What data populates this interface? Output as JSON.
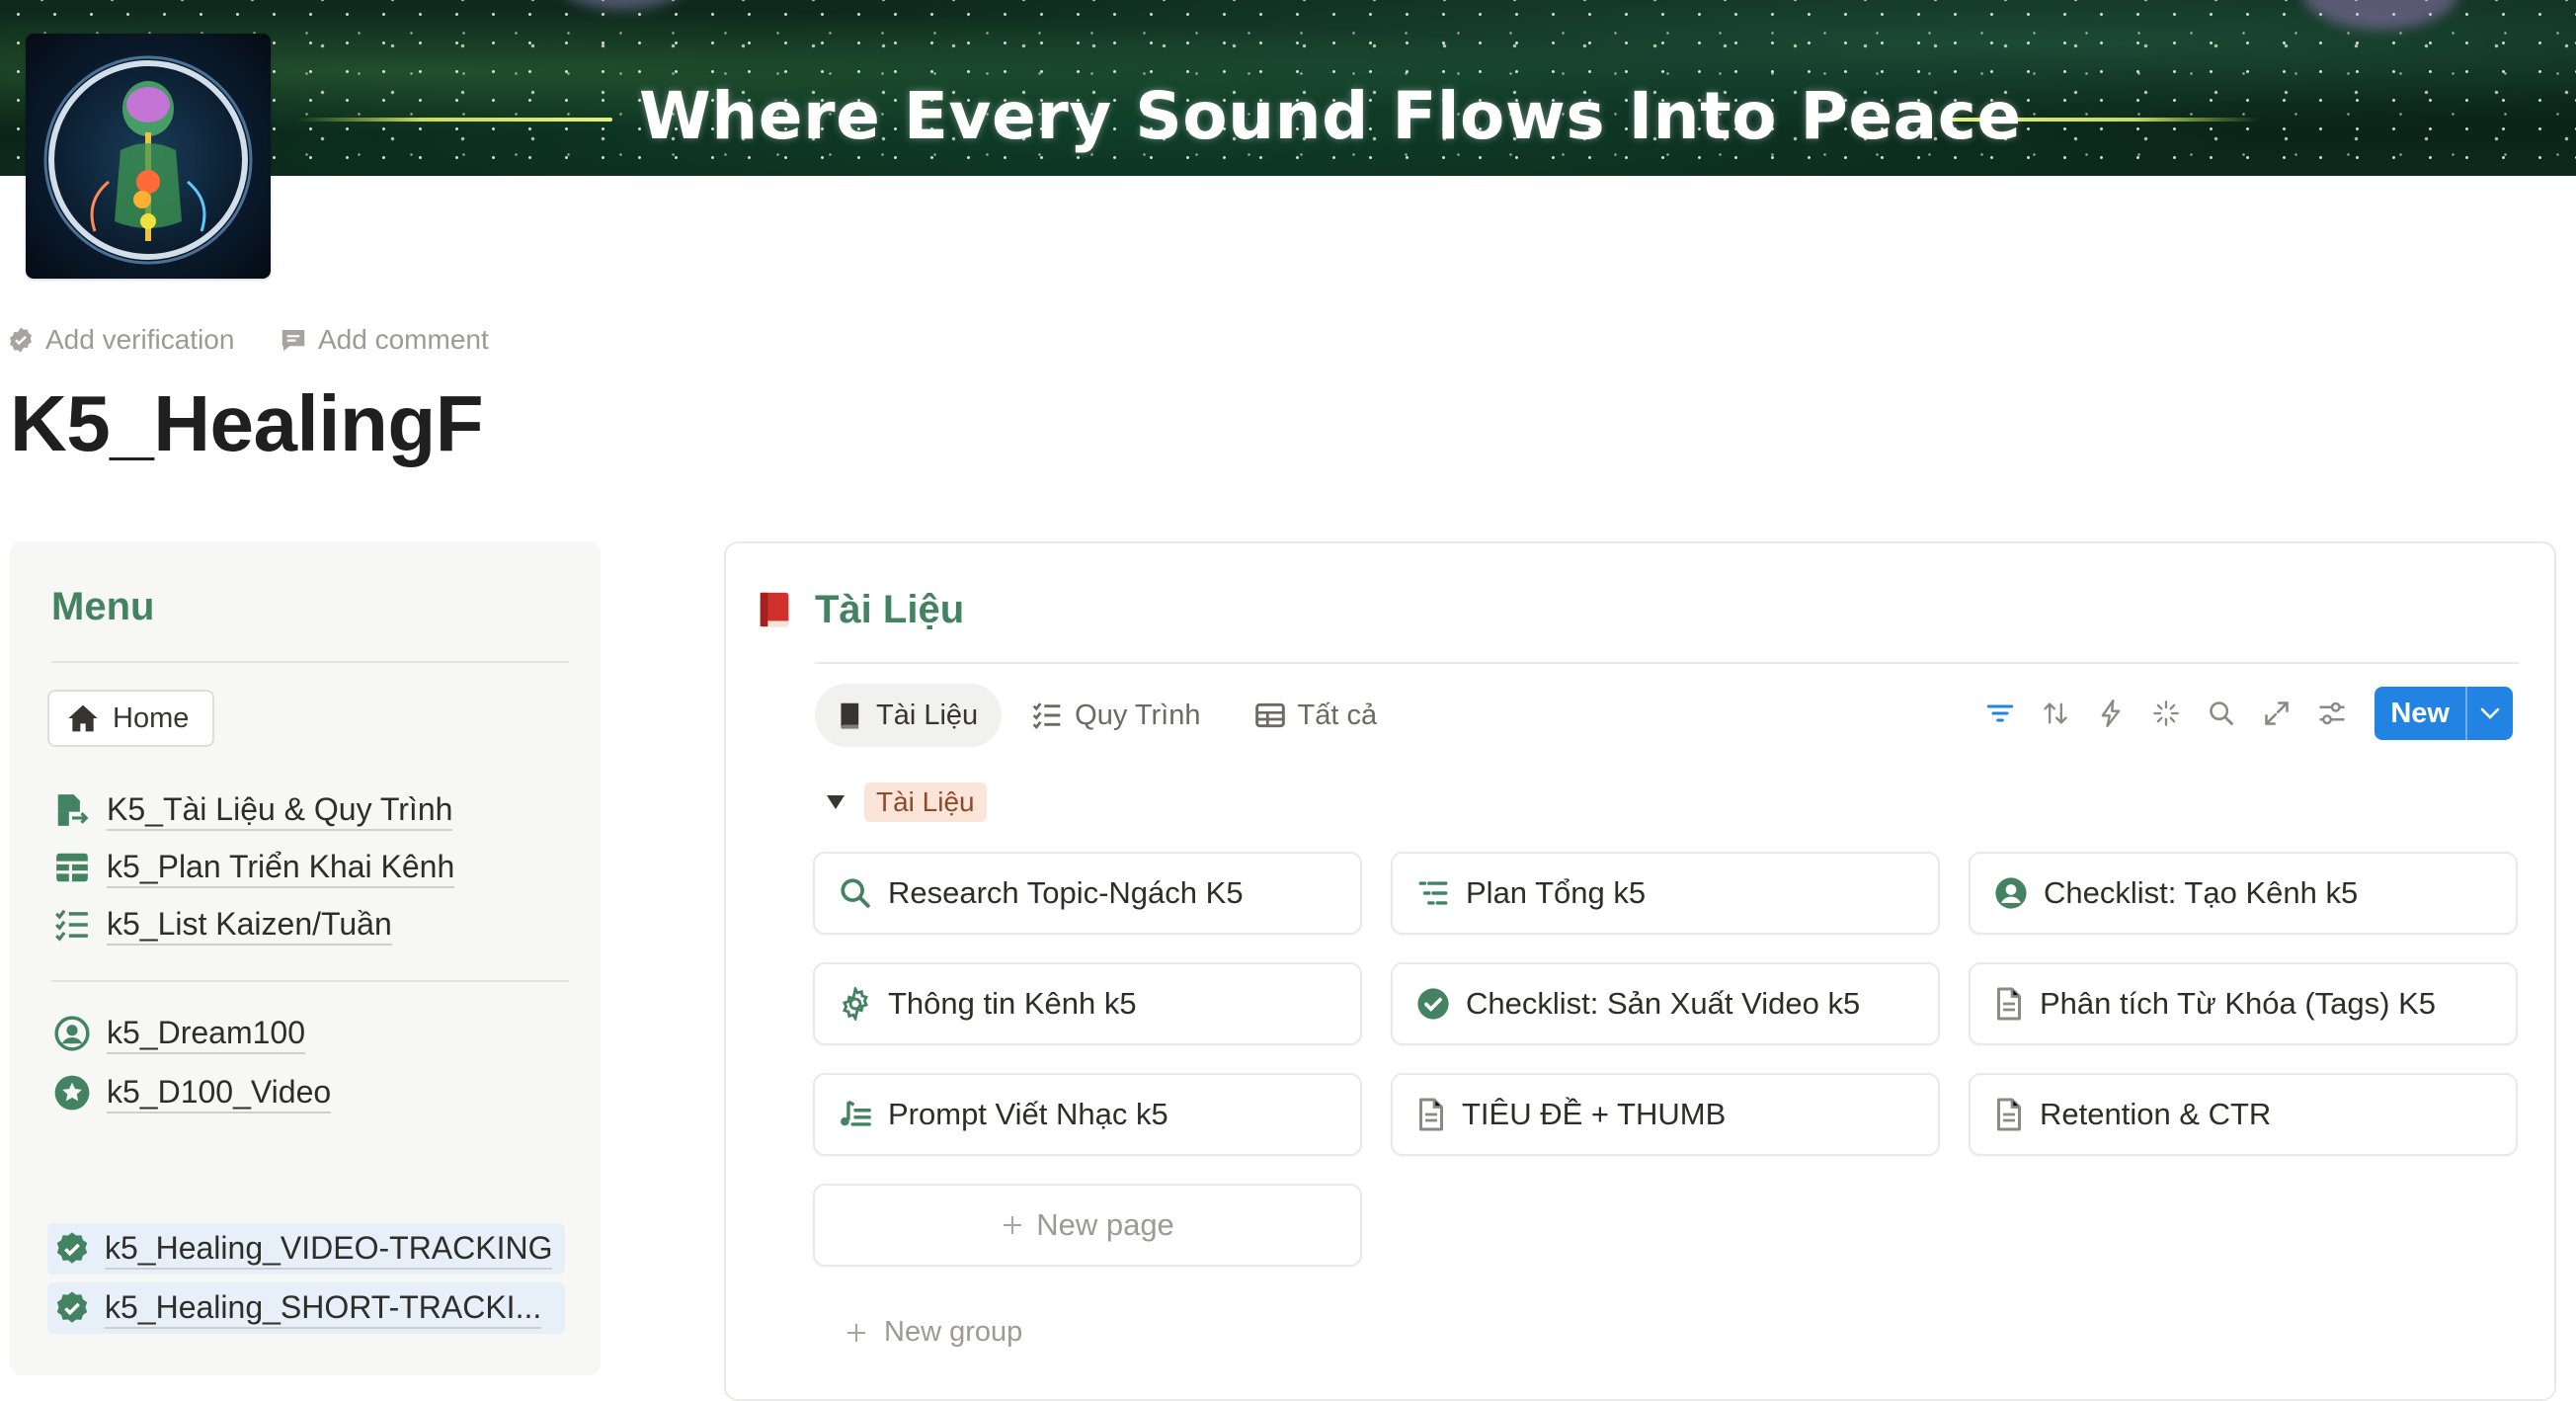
{
  "cover": {
    "subtitle": "Where Every Sound Flows Into Peace"
  },
  "page_actions": {
    "verification": "Add verification",
    "comment": "Add comment"
  },
  "page": {
    "title": "K5_HealingF"
  },
  "menu": {
    "title": "Menu",
    "home_label": "Home",
    "links": [
      {
        "label": "K5_Tài Liệu & Quy Trình",
        "icon": "document-move-icon"
      },
      {
        "label": "k5_Plan Triển Khai Kênh",
        "icon": "table-icon"
      },
      {
        "label": "k5_List Kaizen/Tuần",
        "icon": "checklist-icon"
      },
      {
        "label": "k5_Dream100",
        "icon": "user-circle-icon"
      },
      {
        "label": "k5_D100_Video",
        "icon": "star-badge-icon"
      },
      {
        "label": "k5_Healing_VIDEO-TRACKING",
        "icon": "verified-badge-icon"
      },
      {
        "label": "k5_Healing_SHORT-TRACKI...",
        "icon": "verified-badge-icon"
      }
    ]
  },
  "database": {
    "title": "Tài Liệu",
    "icon": "red-book-icon",
    "tabs": [
      {
        "label": "Tài Liệu",
        "icon": "book-icon",
        "active": true
      },
      {
        "label": "Quy Trình",
        "icon": "checklist-icon",
        "active": false
      },
      {
        "label": "Tất cả",
        "icon": "table-icon",
        "active": false
      }
    ],
    "toolbar_icons": [
      "filter-icon",
      "sort-icon",
      "automation-bolt-icon",
      "ai-sparkle-icon",
      "search-icon",
      "expand-icon",
      "settings-sliders-icon"
    ],
    "new_button": "New",
    "group": {
      "label": "Tài Liệu",
      "expanded": true
    },
    "cards": [
      {
        "title": "Research Topic-Ngách K5",
        "icon": "search-icon"
      },
      {
        "title": "Plan Tổng k5",
        "icon": "list-indent-icon"
      },
      {
        "title": "Checklist: Tạo Kênh k5",
        "icon": "user-circle-icon"
      },
      {
        "title": "Thông tin Kênh k5",
        "icon": "gear-icon"
      },
      {
        "title": "Checklist: Sản Xuất Video k5",
        "icon": "check-circle-icon"
      },
      {
        "title": "Phân tích Từ Khóa (Tags) K5",
        "icon": "page-icon"
      },
      {
        "title": "Prompt Viết Nhạc k5",
        "icon": "music-list-icon"
      },
      {
        "title": "TIÊU ĐỀ + THUMB",
        "icon": "page-icon"
      },
      {
        "title": "Retention & CTR",
        "icon": "page-icon"
      }
    ],
    "new_page_label": "New page",
    "new_group_label": "New group"
  },
  "colors": {
    "accent_green": "#448361",
    "button_blue": "#2383e2",
    "group_pill_bg": "#fbe4d8",
    "highlight_blue": "#e7f0f8"
  }
}
